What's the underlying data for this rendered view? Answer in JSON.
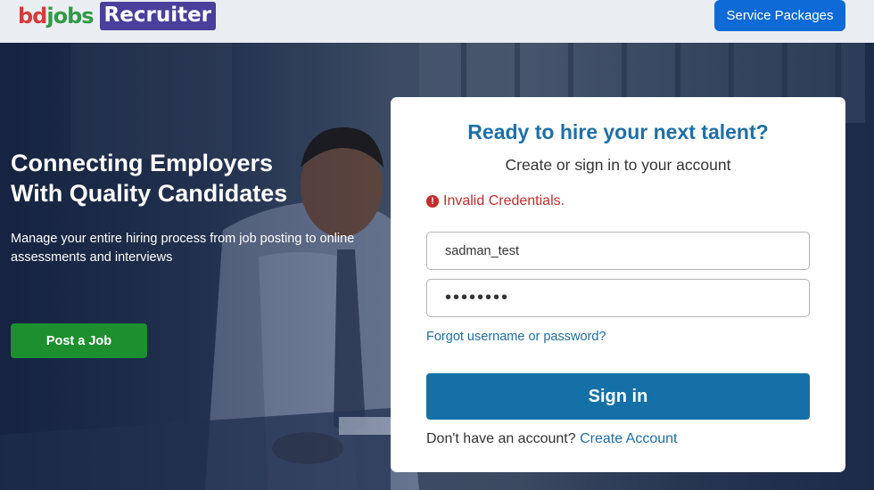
{
  "header": {
    "logo": {
      "bd": "bd",
      "jobs": "jobs",
      "recruiter": "Recruiter"
    },
    "service_packages_label": "Service Packages"
  },
  "hero": {
    "headline_line1": "Connecting Employers",
    "headline_line2": "With Quality Candidates",
    "subtext": "Manage your entire hiring process from job posting to online assessments and interviews",
    "post_job_label": "Post a Job"
  },
  "login": {
    "title": "Ready to hire your next talent?",
    "subtitle": "Create or sign in to your account",
    "error_icon": "!",
    "error_text": "Invalid Credentials.",
    "username_value": "sadman_test",
    "password_value": "••••••••",
    "forgot_label": "Forgot username or password?",
    "signin_label": "Sign in",
    "no_account_text": "Don't have an account?",
    "create_account_label": "Create Account"
  },
  "colors": {
    "brand_purple": "#4a3f9b",
    "primary_blue": "#0d6ad7",
    "signin_blue": "#1470a6",
    "title_blue": "#1d6fa8",
    "post_green": "#1d8f2f",
    "error_red": "#c62c2c"
  }
}
